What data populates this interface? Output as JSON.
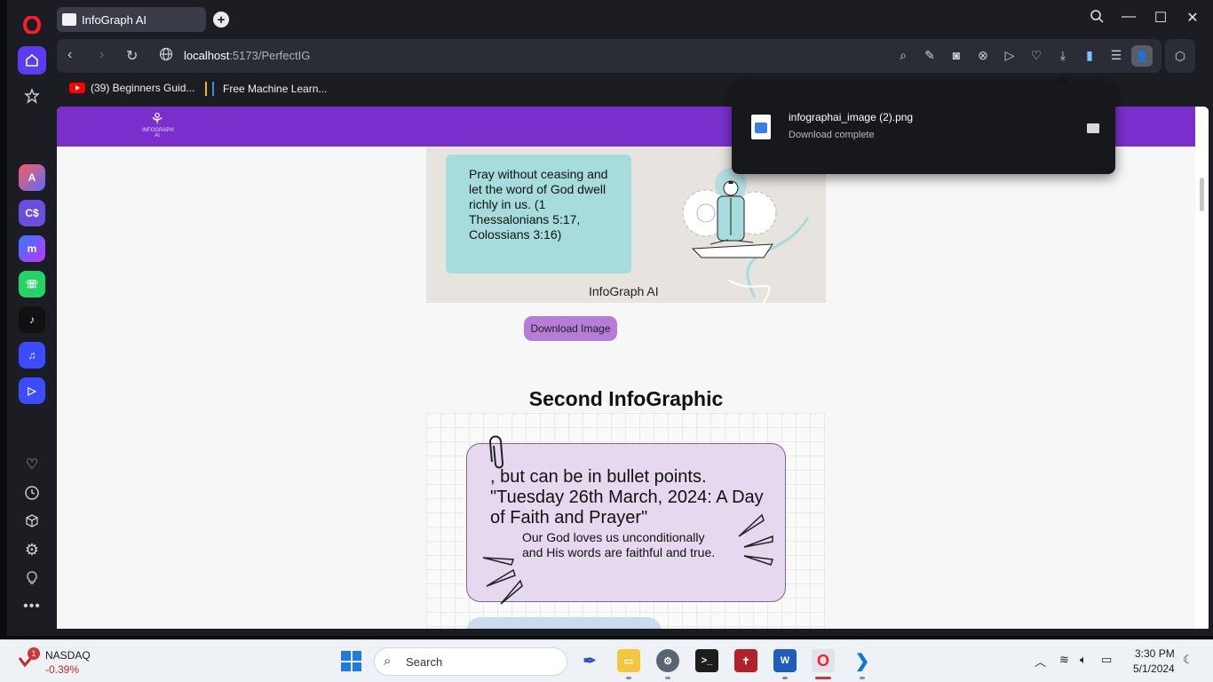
{
  "browser": {
    "tab_title": "InfoGraph AI",
    "url_host": "localhost",
    "url_path": ":5173/PerfectIG",
    "bookmarks": [
      {
        "label": "(39) Beginners Guid..."
      },
      {
        "label": "Free Machine Learn..."
      }
    ]
  },
  "download_popup": {
    "file_name": "infographai_image (2).png",
    "status": "Download complete"
  },
  "page": {
    "logo_text": "INFOGRAPH AI",
    "infographic1": {
      "text": "Pray without ceasing and let the word of God dwell richly in us. (1 Thessalonians 5:17, Colossians 3:16)",
      "caption": "InfoGraph AI"
    },
    "download_button": "Download Image",
    "second_heading": "Second InfoGraphic",
    "infographic2": {
      "title": ", but can be in bullet points. \"Tuesday 26th March, 2024: A Day of Faith and Prayer\"",
      "body": "Our God loves us unconditionally and His words are faithful and true."
    }
  },
  "taskbar": {
    "stock_badge": "1",
    "stock_name": "NASDAQ",
    "stock_change": "-0.39%",
    "search_placeholder": "Search",
    "time": "3:30 PM",
    "date": "5/1/2024"
  },
  "colors": {
    "header_purple": "#7a2fcc",
    "button_purple": "#b57cd8",
    "card_teal": "#a6dcdc",
    "card_lavender": "#e6d8ef"
  }
}
